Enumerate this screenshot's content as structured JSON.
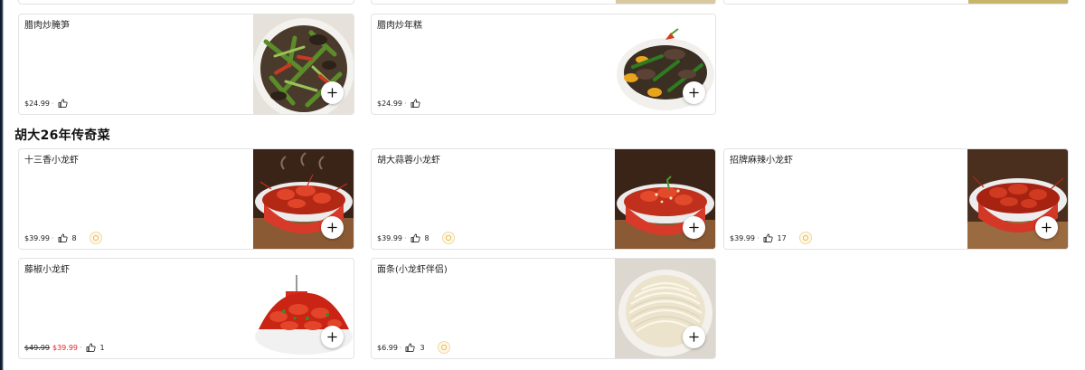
{
  "sections": [
    {
      "title": null,
      "items": [
        {
          "name": "腊肉炒腌笋",
          "price": "$24.99",
          "sale_price": null,
          "likes": null,
          "badge": false,
          "image": "stir-fry-bamboo-shoots"
        },
        {
          "name": "腊肉炒年糕",
          "price": "$24.99",
          "sale_price": null,
          "likes": null,
          "badge": false,
          "image": "stir-fry-rice-cake"
        }
      ]
    },
    {
      "title": "胡大26年传奇菜",
      "items": [
        {
          "name": "十三香小龙虾",
          "price": "$39.99",
          "sale_price": null,
          "likes": "8",
          "badge": true,
          "image": "crawfish-bowl"
        },
        {
          "name": "胡大蒜蓉小龙虾",
          "price": "$39.99",
          "sale_price": null,
          "likes": "8",
          "badge": true,
          "image": "crawfish-bowl"
        },
        {
          "name": "招牌麻辣小龙虾",
          "price": "$39.99",
          "sale_price": null,
          "likes": "17",
          "badge": true,
          "image": "crawfish-bowl"
        },
        {
          "name": "藤椒小龙虾",
          "price": "$49.99",
          "sale_price": "$39.99",
          "likes": "1",
          "badge": false,
          "image": "crawfish-pile"
        },
        {
          "name": "面条(小龙虾伴侣)",
          "price": "$6.99",
          "sale_price": null,
          "likes": "3",
          "badge": true,
          "image": "noodles-bowl"
        }
      ]
    }
  ],
  "icons": {
    "like": "thumbs-up-icon",
    "add": "plus-icon",
    "badge": "recommend-badge-icon"
  },
  "colors": {
    "sale_price": "#e0262c",
    "card_border": "#e3e3e3",
    "badge": "#efd9a6"
  }
}
